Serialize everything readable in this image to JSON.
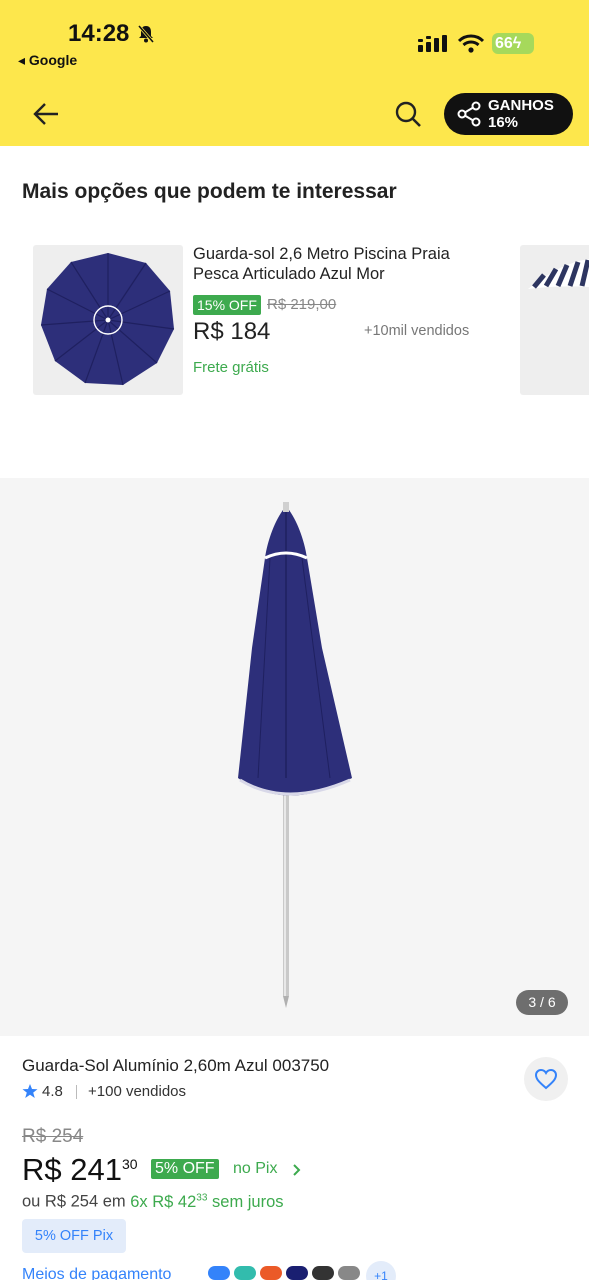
{
  "status_bar": {
    "time": "14:28",
    "back_app": "◂ Google",
    "battery": "66"
  },
  "nav": {
    "earnings_label": "GANHOS",
    "earnings_value": "16%"
  },
  "section_title": "Mais opções que podem te interessar",
  "recommended": {
    "title": "Guarda-sol 2,6 Metro Piscina Praia Pesca Articulado Azul Mor",
    "discount": "15% OFF",
    "old_price": "R$ 219,00",
    "price": "R$ 184",
    "sold": "+10mil vendidos",
    "shipping": "Frete grátis"
  },
  "gallery": {
    "counter": "3 / 6"
  },
  "product": {
    "title": "Guarda-Sol Alumínio 2,60m Azul 003750",
    "rating": "4.8",
    "sold": "+100 vendidos",
    "original_price": "R$ 254",
    "price": "R$ 241",
    "cents": "30",
    "pix_discount": "5% OFF",
    "pix_label": "no Pix",
    "installment_prefix": "ou R$ 254 em",
    "installment_count": "6x R$ 42",
    "installment_cents": "33",
    "installment_suffix": "sem juros",
    "pix_pill": "5% OFF Pix",
    "payment_methods": "Meios de pagamento",
    "payment_more": "+1"
  },
  "colors": {
    "header_bg": "#fde74c",
    "green": "#3daa4e",
    "blue": "#3483fa",
    "umbrella": "#2d2f7a"
  }
}
